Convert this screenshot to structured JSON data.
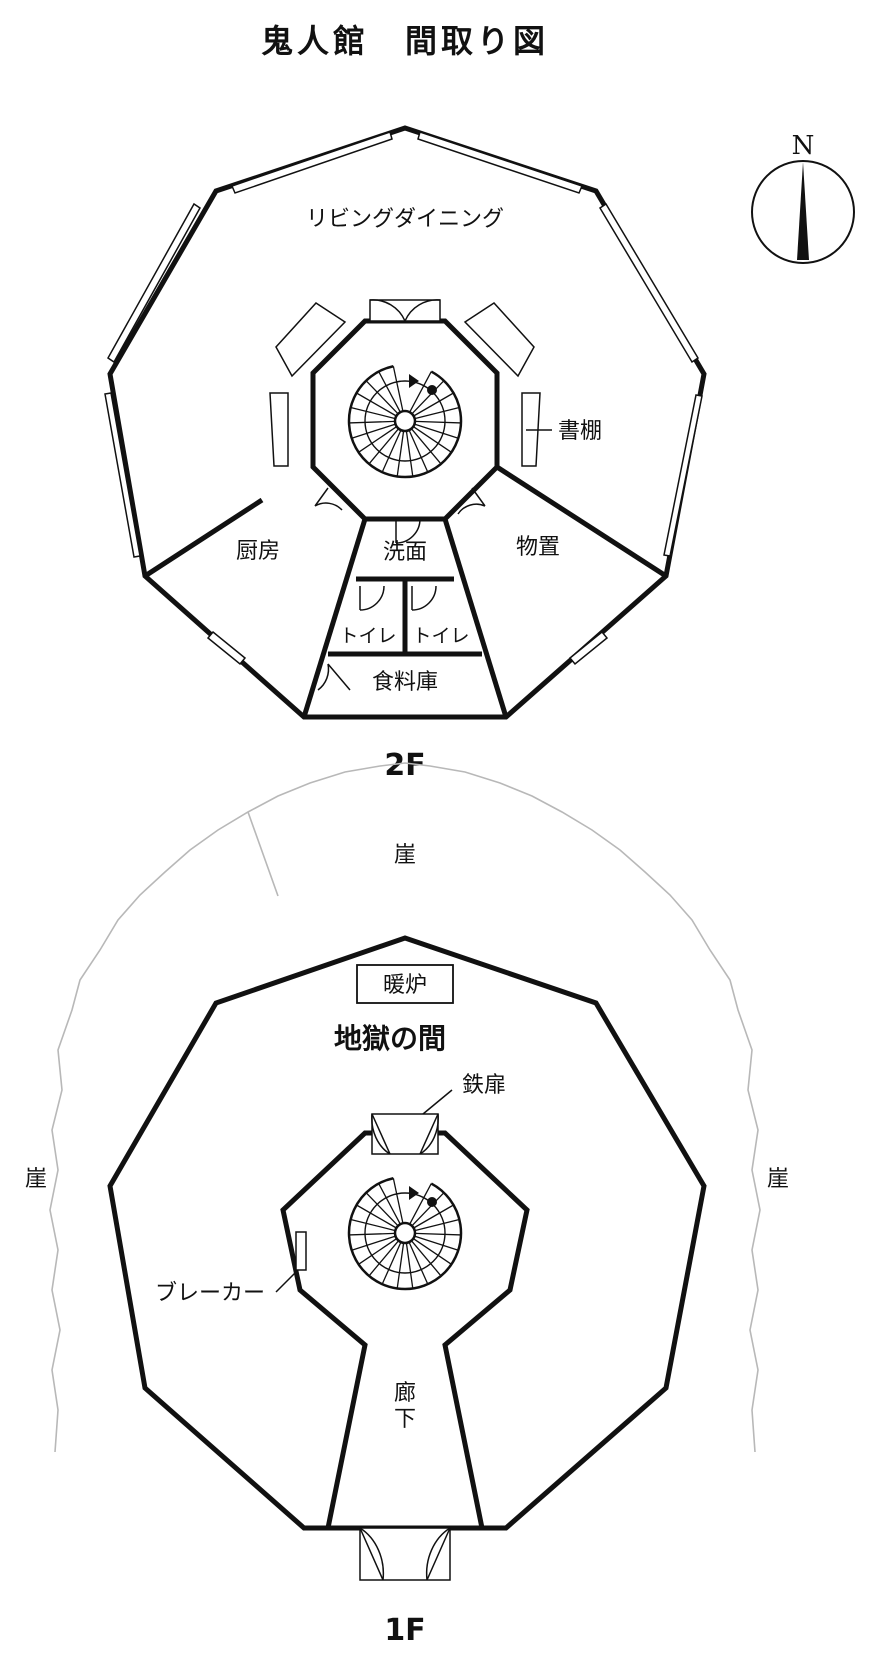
{
  "title": "鬼人館　間取り図",
  "compass": {
    "label": "N",
    "icon": "north-arrow-icon"
  },
  "floor2": {
    "label": "2F",
    "rooms": {
      "living": "リビングダイニング",
      "bookshelf": "書棚",
      "kitchen": "厨房",
      "washroom": "洗面",
      "storage": "物置",
      "toilet_left": "トイレ",
      "toilet_right": "トイレ",
      "pantry": "食料庫"
    }
  },
  "floor1": {
    "label": "1F",
    "rooms": {
      "fireplace": "暖炉",
      "hell_room": "地獄の間",
      "iron_door": "鉄扉",
      "breaker": "ブレーカー",
      "corridor_1": "廊",
      "corridor_2": "下"
    },
    "cliff": {
      "top": "崖",
      "left": "崖",
      "right": "崖"
    }
  },
  "colors": {
    "ink": "#111111",
    "cliff_line": "#b8b8b8",
    "background": "#ffffff"
  }
}
